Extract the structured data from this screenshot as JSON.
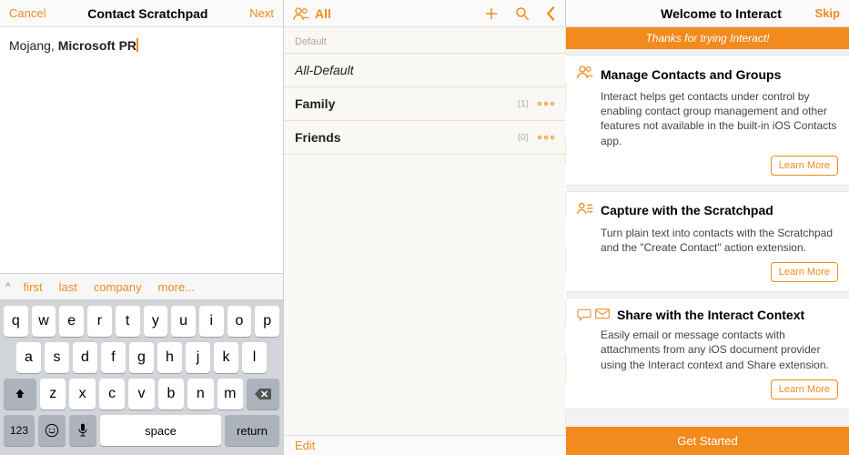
{
  "panel1": {
    "cancel": "Cancel",
    "title": "Contact Scratchpad",
    "next": "Next",
    "input_plain": "Mojang, ",
    "input_bold": "Microsoft PR",
    "suggest": {
      "first": "first",
      "last": "last",
      "company": "company",
      "more": "more..."
    },
    "keys": {
      "r1": [
        "q",
        "w",
        "e",
        "r",
        "t",
        "y",
        "u",
        "i",
        "o",
        "p"
      ],
      "r2": [
        "a",
        "s",
        "d",
        "f",
        "g",
        "h",
        "j",
        "k",
        "l"
      ],
      "r3": [
        "z",
        "x",
        "c",
        "v",
        "b",
        "n",
        "m"
      ],
      "num": "123",
      "space": "space",
      "return": "return"
    }
  },
  "panel2": {
    "all": "All",
    "section": "Default",
    "rows": [
      {
        "name": "All-Default",
        "italic": true
      },
      {
        "name": "Family",
        "count": "(1)"
      },
      {
        "name": "Friends",
        "count": "(0)"
      }
    ],
    "edit": "Edit"
  },
  "panel3": {
    "title": "Welcome to Interact",
    "skip": "Skip",
    "banner": "Thanks for trying Interact!",
    "learn": "Learn More",
    "cta": "Get Started",
    "cards": [
      {
        "title": "Manage Contacts and Groups",
        "body": "Interact helps get contacts under control by enabling contact group management and other features not available in the built-in iOS Contacts app."
      },
      {
        "title": "Capture with the Scratchpad",
        "body": "Turn plain text into contacts with the Scratchpad and the \"Create Contact\" action extension."
      },
      {
        "title": "Share with the Interact Context",
        "body": "Easily email or message contacts with attachments from any iOS document provider using the Interact context and Share extension."
      }
    ]
  }
}
